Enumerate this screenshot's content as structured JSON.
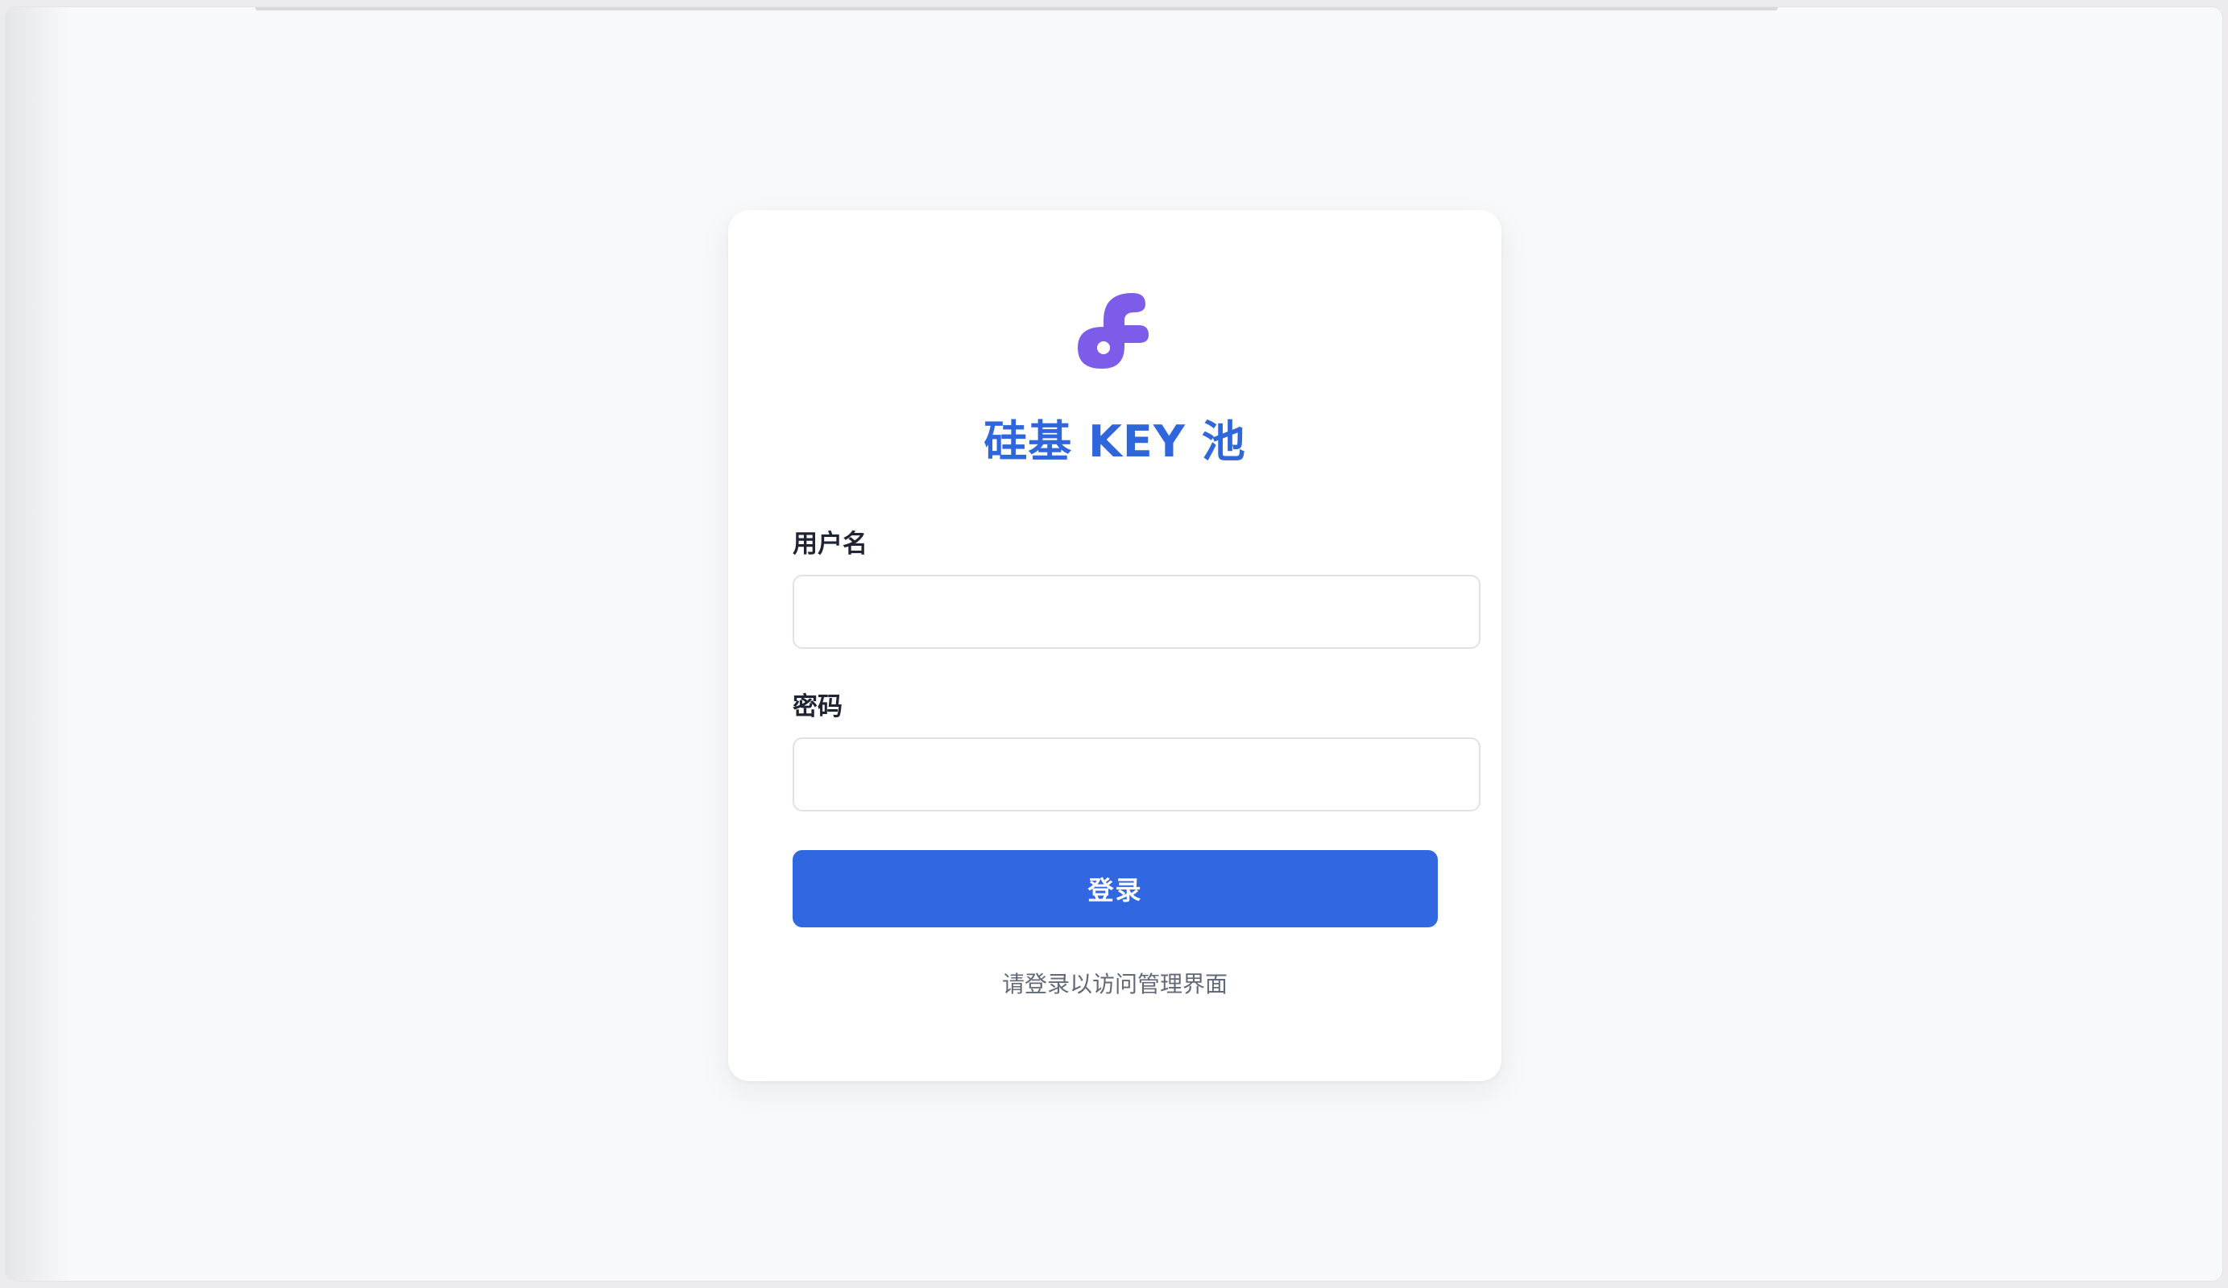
{
  "card": {
    "title": "硅基 KEY 池",
    "logo_icon": "stylized-f-logo-icon",
    "brand_color": "#2f66dc",
    "logo_color": "#7c5ce8"
  },
  "form": {
    "username_label": "用户名",
    "username_value": "",
    "password_label": "密码",
    "password_value": "",
    "submit_label": "登录",
    "submit_color": "#3167e0"
  },
  "footer": {
    "hint": "请登录以访问管理界面"
  }
}
